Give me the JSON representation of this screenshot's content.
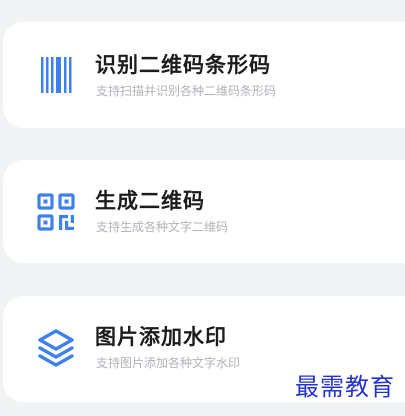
{
  "cards": [
    {
      "title": "识别二维码条形码",
      "subtitle": "支持扫描并识别各种二维码条形码",
      "icon": "barcode-icon"
    },
    {
      "title": "生成二维码",
      "subtitle": "支持生成各种文字二维码",
      "icon": "qr-code-icon"
    },
    {
      "title": "图片添加水印",
      "subtitle": "支持图片添加各种文字水印",
      "icon": "layers-icon"
    }
  ],
  "watermark": "最需教育",
  "colors": {
    "accent": "#3f80f0",
    "background": "#f2f3f5",
    "card": "#ffffff",
    "title": "#1c1c1e",
    "subtitle": "#b0b3b8",
    "watermark": "#2433d6"
  }
}
